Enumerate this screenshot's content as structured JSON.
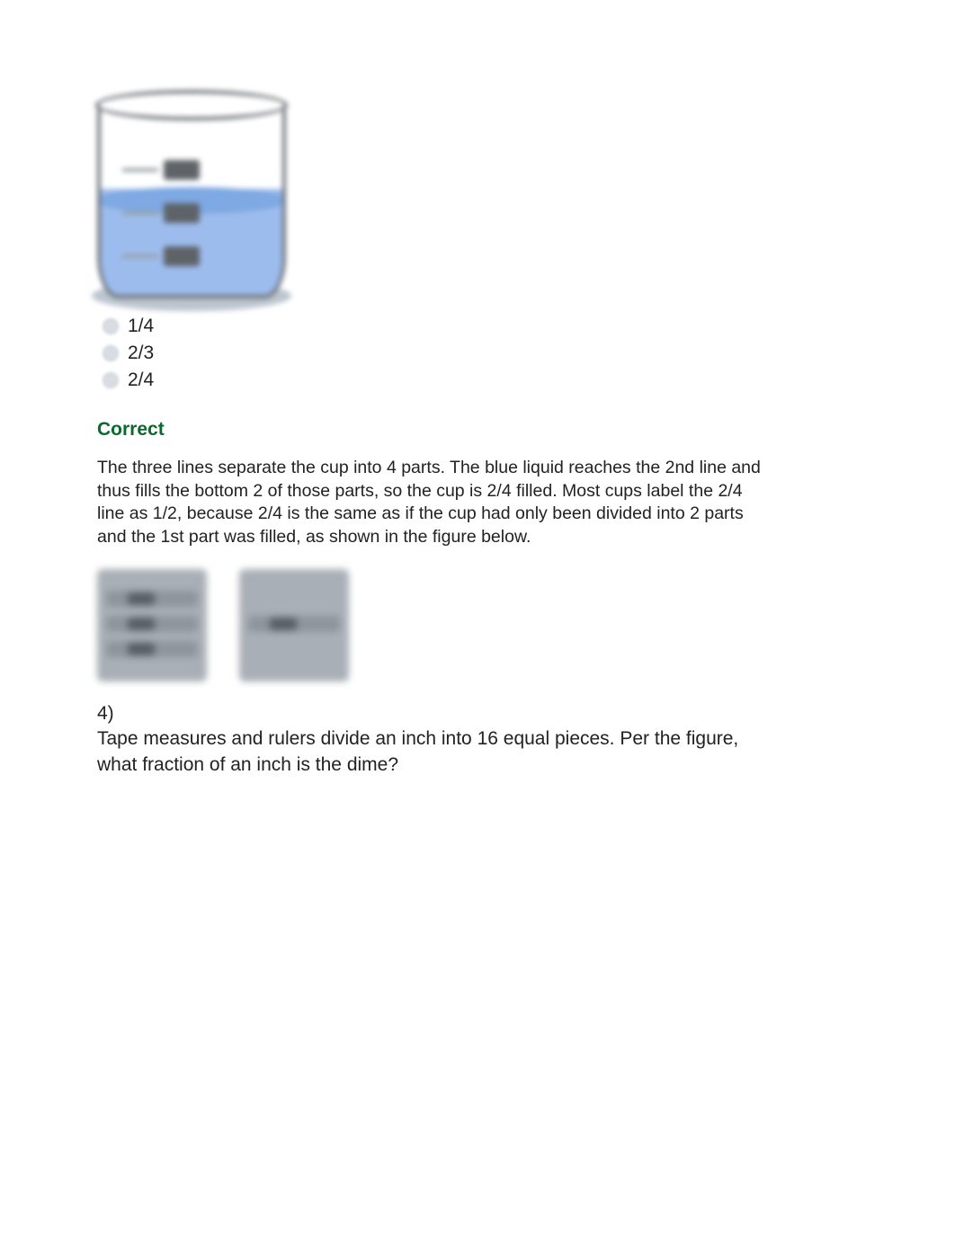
{
  "cup": {
    "marks": [
      "3/4",
      "1/2",
      "1/4"
    ]
  },
  "options": [
    {
      "label": "1/4"
    },
    {
      "label": "2/3"
    },
    {
      "label": "2/4"
    }
  ],
  "feedback": {
    "title": "Correct",
    "text": "The three lines separate the cup into 4 parts. The blue liquid reaches the 2nd line and thus fills the bottom 2 of those parts, so the cup is 2/4 filled. Most cups label the 2/4 line as 1/2, because 2/4 is the same as if the cup had only been divided into 2 parts and the 1st part was filled, as shown in the figure below."
  },
  "question4": {
    "number": "4)",
    "text": "Tape measures and rulers divide an inch into 16 equal pieces. Per the figure, what fraction of an inch is the dime?"
  }
}
